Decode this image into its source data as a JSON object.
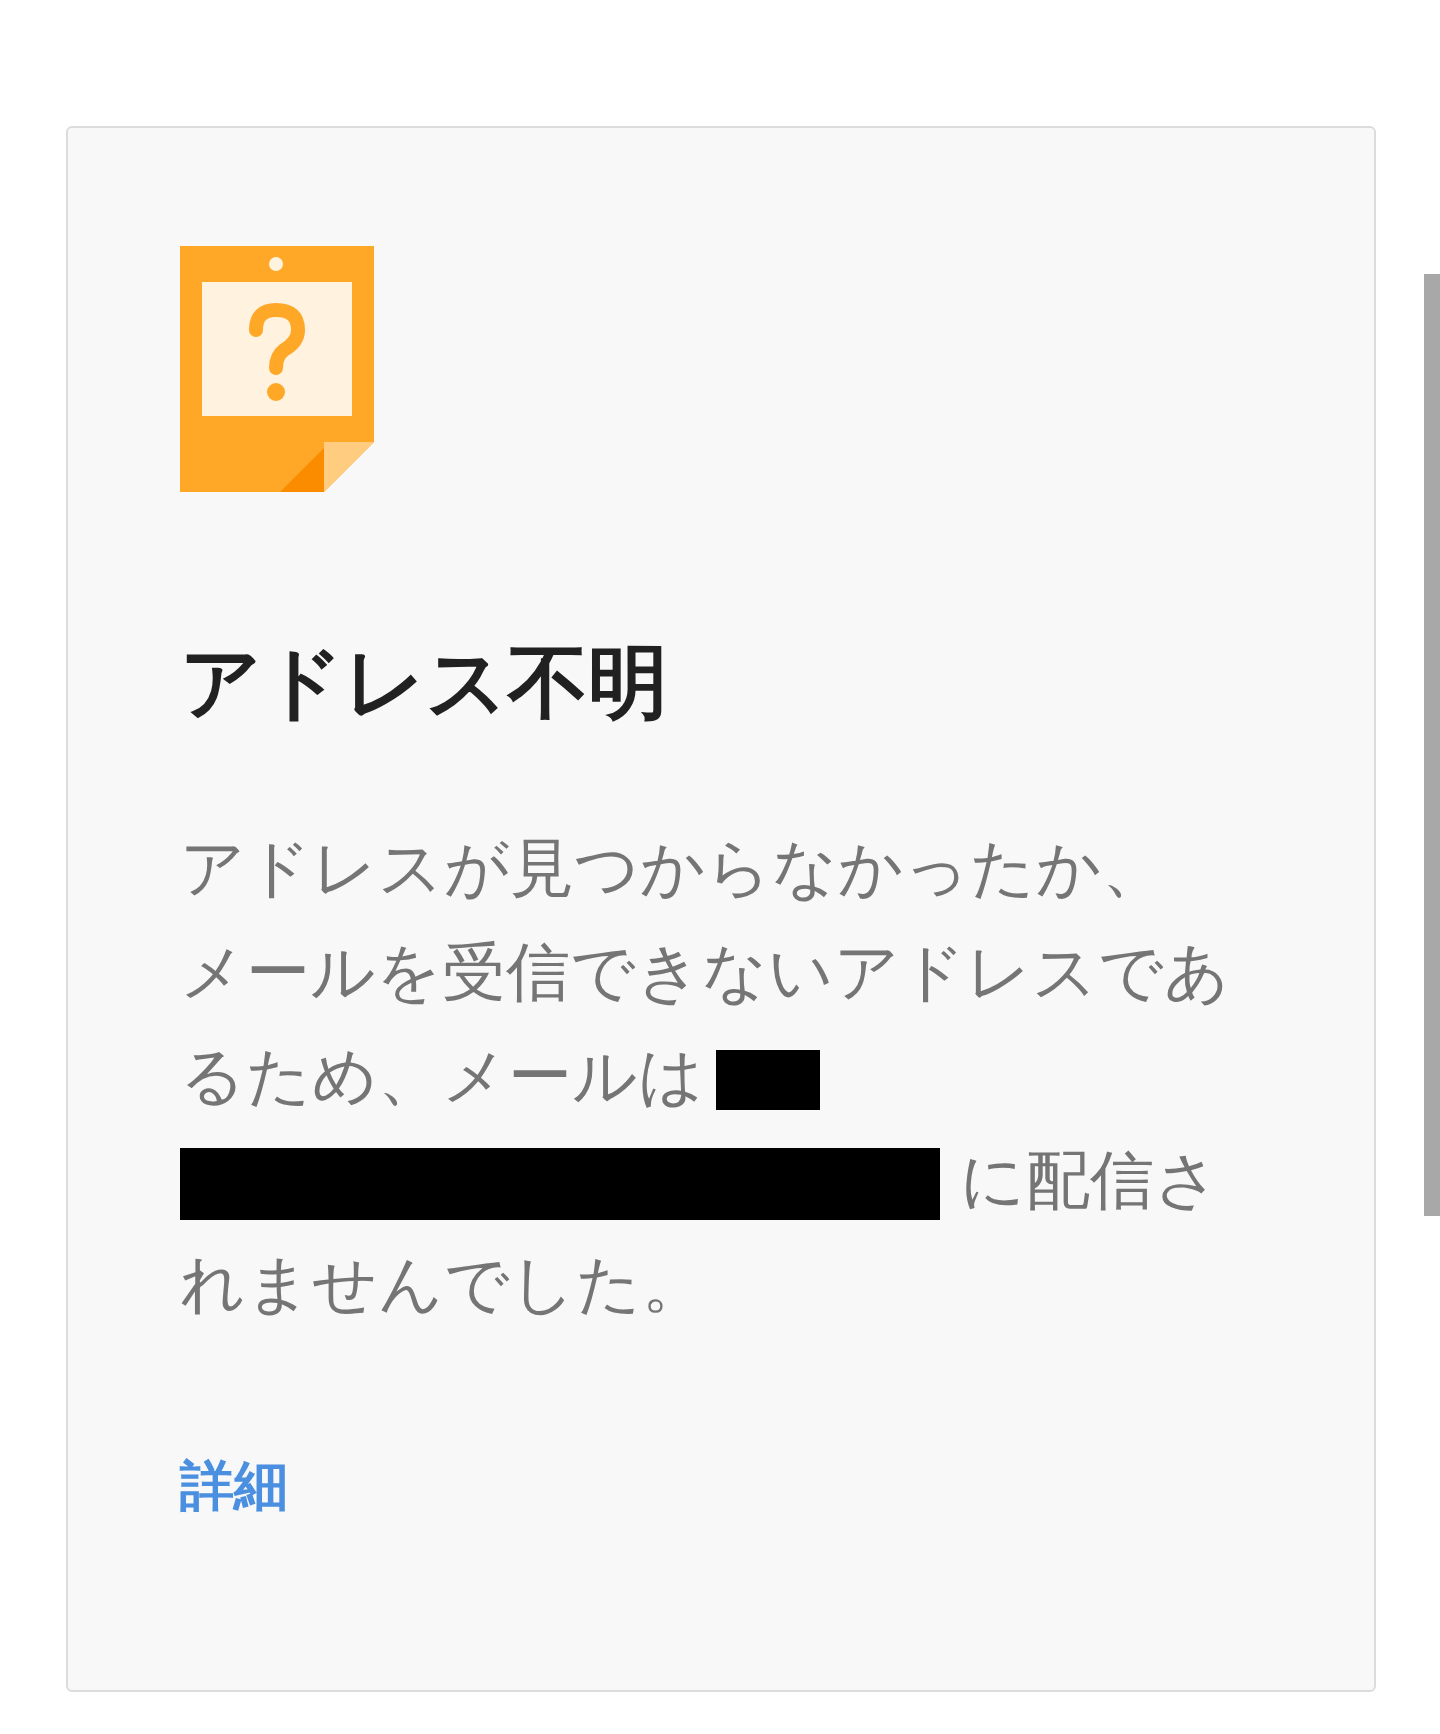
{
  "card": {
    "title": "アドレス不明",
    "message": {
      "before": "アドレスが見つからなかったか、メールを受信できないアドレスであるため、メールは",
      "redacted": true,
      "after": "に配信されませんでした。"
    },
    "link": "詳細"
  }
}
